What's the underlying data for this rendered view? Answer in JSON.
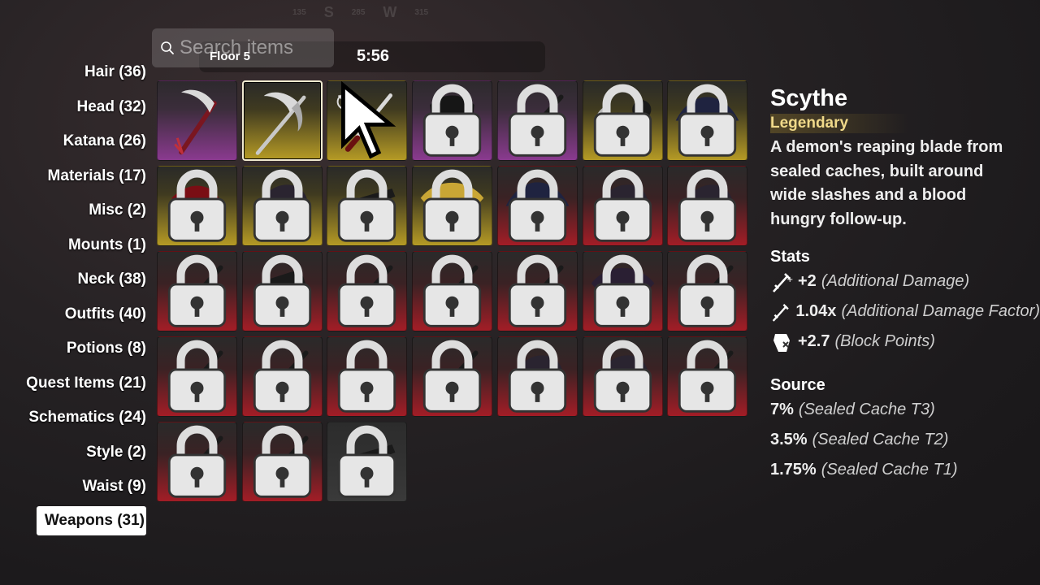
{
  "compass": {
    "left_tick": "135",
    "dir1": "S",
    "mid_tick": "285",
    "dir2": "W",
    "right_tick": "315"
  },
  "search": {
    "placeholder": "Search items"
  },
  "hud": {
    "floor": "Floor 5",
    "timer": "5:56"
  },
  "categories": [
    {
      "label": "Hair (36)"
    },
    {
      "label": "Head (32)"
    },
    {
      "label": "Katana (26)"
    },
    {
      "label": "Materials (17)"
    },
    {
      "label": "Misc (2)"
    },
    {
      "label": "Mounts (1)"
    },
    {
      "label": "Neck (38)"
    },
    {
      "label": "Outfits (40)"
    },
    {
      "label": "Potions (8)"
    },
    {
      "label": "Quest Items (21)"
    },
    {
      "label": "Schematics (24)"
    },
    {
      "label": "Style (2)"
    },
    {
      "label": "Waist (9)"
    },
    {
      "label": "Weapons (31)",
      "selected": true
    }
  ],
  "items": [
    {
      "rarity": "purple",
      "locked": false,
      "icon": "scythe-icon"
    },
    {
      "rarity": "gold",
      "locked": false,
      "icon": "double-scythe-icon",
      "selected": true
    },
    {
      "rarity": "gold",
      "locked": false,
      "icon": "katana-icon",
      "hidden_badge": true
    },
    {
      "rarity": "purple",
      "locked": true,
      "icon": "dark-cloak-icon"
    },
    {
      "rarity": "purple",
      "locked": true,
      "icon": "spear-icon"
    },
    {
      "rarity": "gold",
      "locked": true,
      "icon": "axe-flail-icon"
    },
    {
      "rarity": "gold",
      "locked": true,
      "icon": "parasol-icon"
    },
    {
      "rarity": "gold",
      "locked": true,
      "icon": "red-blade-icon"
    },
    {
      "rarity": "gold",
      "locked": true,
      "icon": "gauntlet-icon"
    },
    {
      "rarity": "gold",
      "locked": true,
      "icon": "pistol-icon"
    },
    {
      "rarity": "gold",
      "locked": true,
      "icon": "war-fan-icon"
    },
    {
      "rarity": "red",
      "locked": true,
      "icon": "umbrella-icon"
    },
    {
      "rarity": "red",
      "locked": true,
      "icon": "claw-icon"
    },
    {
      "rarity": "red",
      "locked": true,
      "icon": "fist-icon"
    },
    {
      "rarity": "red",
      "locked": true,
      "icon": "sickle-icon"
    },
    {
      "rarity": "red",
      "locked": true,
      "icon": "cannon-icon"
    },
    {
      "rarity": "red",
      "locked": true,
      "icon": "double-sickle-icon"
    },
    {
      "rarity": "red",
      "locked": true,
      "icon": "lance-icon"
    },
    {
      "rarity": "red",
      "locked": true,
      "icon": "cleaver-icon"
    },
    {
      "rarity": "red",
      "locked": true,
      "icon": "feather-fan-icon"
    },
    {
      "rarity": "red",
      "locked": true,
      "icon": "dark-scythe-icon"
    },
    {
      "rarity": "red",
      "locked": true,
      "icon": "kunai-icon"
    },
    {
      "rarity": "red",
      "locked": true,
      "icon": "dagger-icon"
    },
    {
      "rarity": "red",
      "locked": true,
      "icon": "spiked-shell-icon"
    },
    {
      "rarity": "red",
      "locked": true,
      "icon": "mace-chain-icon"
    },
    {
      "rarity": "red",
      "locked": true,
      "icon": "bone-claw-icon"
    },
    {
      "rarity": "red",
      "locked": true,
      "icon": "armored-fist-icon"
    },
    {
      "rarity": "red",
      "locked": true,
      "icon": "hook-scythe-icon"
    },
    {
      "rarity": "red",
      "locked": true,
      "icon": "crescent-blade-icon"
    },
    {
      "rarity": "red",
      "locked": true,
      "icon": "flame-flail-icon"
    },
    {
      "rarity": "gray",
      "locked": true,
      "icon": "flintlock-icon"
    }
  ],
  "detail": {
    "name": "Scythe",
    "rarity": "Legendary",
    "description": "A demon's reaping blade from sealed caches, built around wide slashes and a blood hungry follow-up.",
    "stats_title": "Stats",
    "stats": [
      {
        "icon": "damage-icon",
        "value": "+2",
        "label": "(Additional Damage)"
      },
      {
        "icon": "damage-factor-icon",
        "value": "1.04x",
        "label": "(Additional Damage Factor)"
      },
      {
        "icon": "block-icon",
        "value": "+2.7",
        "label": "(Block Points)"
      }
    ],
    "source_title": "Source",
    "sources": [
      {
        "pct": "7%",
        "label": "(Sealed Cache T3)"
      },
      {
        "pct": "3.5%",
        "label": "(Sealed Cache T2)"
      },
      {
        "pct": "1.75%",
        "label": "(Sealed Cache T1)"
      }
    ]
  },
  "colors": {
    "legendary": "#f0d98a",
    "purple": "#8a3a8f",
    "gold": "#b59a25",
    "red": "#a31d26"
  }
}
